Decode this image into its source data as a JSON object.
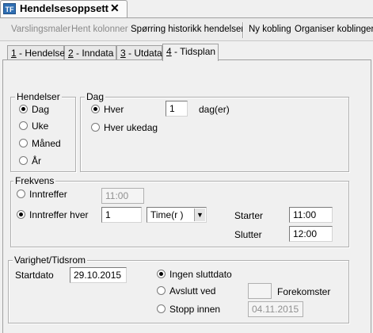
{
  "window": {
    "tab_title": "Hendelsesoppsett",
    "app_icon_text": "TF"
  },
  "toolbar": {
    "varslingsmaler": "Varslingsmaler",
    "hent_kolonner": "Hent kolonner",
    "sporring": "Spørring historikk hendelser",
    "ny_kobling": "Ny kobling",
    "organiser": "Organiser koblinger"
  },
  "tabs": [
    {
      "num": "1",
      "label": " - Hendelse"
    },
    {
      "num": "2",
      "label": " - Inndata"
    },
    {
      "num": "3",
      "label": " - Utdata"
    },
    {
      "num": "4",
      "label": " - Tidsplan"
    }
  ],
  "hendelser": {
    "title": "Hendelser",
    "options": [
      "Dag",
      "Uke",
      "Måned",
      "År"
    ],
    "selected_index": 0
  },
  "dag": {
    "title": "Dag",
    "hver_label": "Hver",
    "hver_value": "1",
    "unit": "dag(er)",
    "ukedag_label": "Hver ukedag",
    "selected": "hver"
  },
  "frekvens": {
    "title": "Frekvens",
    "inntreffer_label": "Inntreffer",
    "inntreffer_value": "11:00",
    "inntreffer_hver_label": "Inntreffer hver",
    "hver_value": "1",
    "unit_selected": "Time(r )",
    "starter_label": "Starter",
    "starter_value": "11:00",
    "slutter_label": "Slutter",
    "slutter_value": "12:00",
    "selected": "inntreffer_hver"
  },
  "varighet": {
    "title": "Varighet/Tidsrom",
    "startdato_label": "Startdato",
    "startdato_value": "29.10.2015",
    "ingen_label": "Ingen sluttdato",
    "avslutt_label": "Avslutt ved",
    "avslutt_value": "",
    "forekomster_label": "Forekomster",
    "stopp_label": "Stopp innen",
    "stopp_value": "04.11.2015",
    "selected": "ingen"
  }
}
